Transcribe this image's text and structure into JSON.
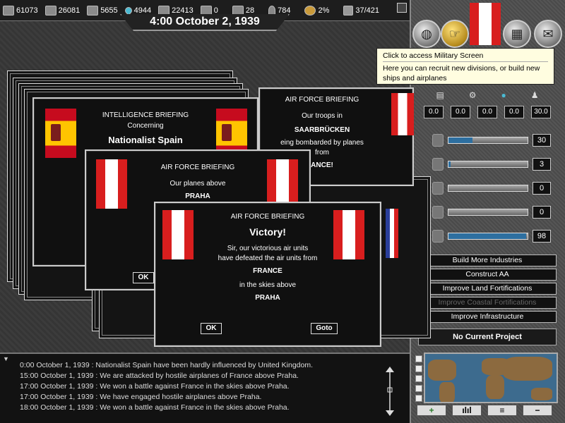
{
  "resources": [
    {
      "icon": "energy-icon",
      "value": "61073"
    },
    {
      "icon": "metal-icon",
      "value": "26081"
    },
    {
      "icon": "rare-materials-icon",
      "value": "5655"
    },
    {
      "icon": "oil-icon",
      "value": "4944"
    },
    {
      "icon": "supplies-icon",
      "value": "22413"
    },
    {
      "icon": "transport-icon",
      "value": "0"
    },
    {
      "icon": "money-icon",
      "value": "28"
    },
    {
      "icon": "manpower-icon",
      "value": "784"
    },
    {
      "icon": "dissent-icon",
      "value": "2%"
    },
    {
      "icon": "divisions-icon",
      "value": "37/421"
    }
  ],
  "date": "4:00 October 2, 1939",
  "tooltip": {
    "title": "Click to access Military Screen",
    "body": "Here you can recruit new divisions, or build new ships and airplanes"
  },
  "stats": [
    "0.0",
    "0.0",
    "0.0",
    "0.0",
    "30.0"
  ],
  "sliders": [
    {
      "value": "30",
      "fill": 0.3
    },
    {
      "value": "3",
      "fill": 0.03
    },
    {
      "value": "0",
      "fill": 0.0
    },
    {
      "value": "0",
      "fill": 0.0
    },
    {
      "value": "98",
      "fill": 0.98
    }
  ],
  "projects": [
    {
      "label": "Build More Industries",
      "enabled": true
    },
    {
      "label": "Construct AA",
      "enabled": true
    },
    {
      "label": "Improve Land Fortifications",
      "enabled": true
    },
    {
      "label": "Improve Coastal Fortifications",
      "enabled": false
    },
    {
      "label": "Improve Infrastructure",
      "enabled": true
    }
  ],
  "no_project": "No Current Project",
  "log": [
    "0:00 October 1, 1939 : Nationalist Spain have been hardly influenced by United Kingdom.",
    "15:00 October 1, 1939 : We are attacked by hostile airplanes of France above Praha.",
    "17:00 October 1, 1939 : We won a battle against France in the skies above Praha.",
    "17:00 October 1, 1939 : We have engaged hostile airplanes above Praha.",
    "18:00 October 1, 1939 : We won a battle against France in the skies above Praha."
  ],
  "briefings": {
    "intel": {
      "header": "INTELLIGENCE BRIEFING",
      "line1": "Concerning",
      "line2": "Nationalist Spain"
    },
    "air1": {
      "header": "AIR FORCE BRIEFING",
      "line1": "Our troops in",
      "line2": "SAARBRÜCKEN",
      "line3": "eing bombarded by planes",
      "line4": "from",
      "line5": "ANCE!"
    },
    "air2": {
      "header": "AIR FORCE BRIEFING",
      "line1": "Our planes above",
      "line2": "PRAHA",
      "ok": "OK"
    },
    "victory": {
      "header": "AIR FORCE BRIEFING",
      "title": "Victory!",
      "line1": "Sir, our victorious air units",
      "line2": "have defeated the air units from",
      "line3": "FRANCE",
      "line4": "in the skies above",
      "line5": "PRAHA",
      "ok": "OK",
      "goto": "Goto"
    }
  },
  "minimap_buttons": [
    "+",
    "ılıl",
    "≡",
    "−"
  ]
}
